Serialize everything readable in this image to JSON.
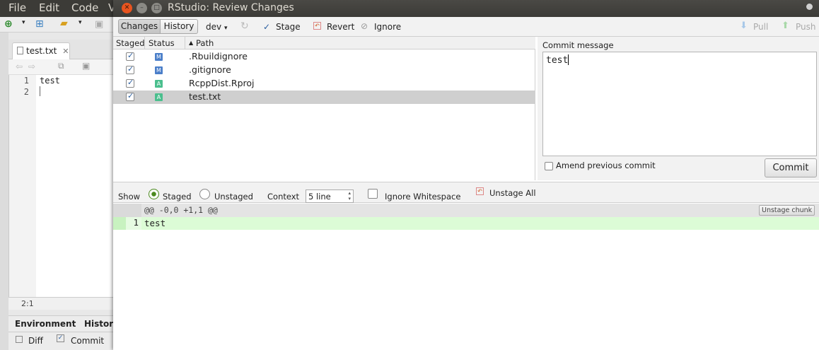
{
  "bg": {
    "menu": [
      "File",
      "Edit",
      "Code",
      "V"
    ],
    "tab_label": "test.txt",
    "line_numbers": [
      "1",
      "2"
    ],
    "code_lines": [
      "test",
      ""
    ],
    "cursor_pos": "2:1",
    "bottom_tabs": [
      "Environment",
      "History"
    ],
    "bottom_buttons": [
      "Diff",
      "Commit"
    ]
  },
  "dialog": {
    "title": "RStudio: Review Changes",
    "toolbar": {
      "changes_label": "Changes",
      "history_label": "History",
      "branch": "dev",
      "stage_label": "Stage",
      "revert_label": "Revert",
      "ignore_label": "Ignore",
      "pull_label": "Pull",
      "push_label": "Push"
    },
    "columns": {
      "staged": "Staged",
      "status": "Status",
      "path": "Path"
    },
    "files": [
      {
        "staged": true,
        "status": "M",
        "path": ".Rbuildignore"
      },
      {
        "staged": true,
        "status": "M",
        "path": ".gitignore"
      },
      {
        "staged": true,
        "status": "A",
        "path": "RcppDist.Rproj"
      },
      {
        "staged": true,
        "status": "A",
        "path": "test.txt"
      }
    ],
    "commit": {
      "label": "Commit message",
      "message": "test",
      "amend_label": "Amend previous commit",
      "button": "Commit"
    },
    "diffbar": {
      "show_label": "Show",
      "staged_label": "Staged",
      "unstaged_label": "Unstaged",
      "context_label": "Context",
      "context_value": "5 line",
      "ignore_ws_label": "Ignore Whitespace",
      "unstage_all_label": "Unstage All"
    },
    "diff": {
      "hunk_header": "@@ -0,0 +1,1 @@",
      "unstage_chunk": "Unstage chunk",
      "lines": [
        {
          "num": "1",
          "text": "test"
        }
      ]
    }
  },
  "colors": {
    "modified": "#4a7ec9",
    "added": "#4bbf8e",
    "added_line": "#dcfcd6",
    "titlebar": "#3c3b37"
  }
}
